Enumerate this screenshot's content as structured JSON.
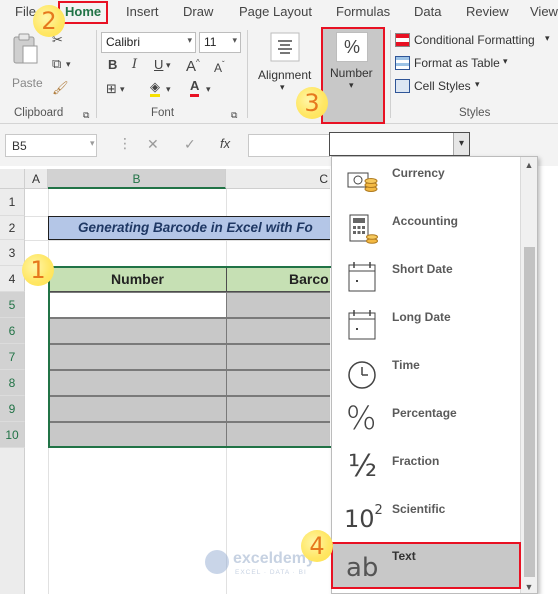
{
  "ribbon": {
    "tabs": [
      "File",
      "Home",
      "Insert",
      "Draw",
      "Page Layout",
      "Formulas",
      "Data",
      "Review",
      "View"
    ],
    "active_tab": "Home",
    "clipboard": {
      "paste_label": "Paste",
      "group_label": "Clipboard"
    },
    "font": {
      "family": "Calibri",
      "size": "11",
      "group_label": "Font",
      "bold": "B",
      "italic": "I",
      "underline": "U"
    },
    "alignment": {
      "label": "Alignment"
    },
    "number": {
      "label": "Number",
      "symbol": "%"
    },
    "styles": {
      "conditional_formatting": "Conditional Formatting",
      "format_as_table": "Format as Table",
      "cell_styles": "Cell Styles",
      "group_label": "Styles"
    }
  },
  "callouts": [
    "1",
    "2",
    "3",
    "4"
  ],
  "formula_bar": {
    "name_box": "B5",
    "cancel": "✕",
    "enter": "✓",
    "fx": "fx"
  },
  "sheet": {
    "columns": [
      "A",
      "B",
      "C"
    ],
    "rows": [
      "1",
      "2",
      "3",
      "4",
      "5",
      "6",
      "7",
      "8",
      "9",
      "10"
    ],
    "title": "Generating Barcode in Excel with Fo",
    "headers": {
      "number": "Number",
      "barcode": "Barco"
    }
  },
  "number_format_menu": {
    "items": [
      {
        "label": "Currency",
        "icon": "currency-icon"
      },
      {
        "label": "Accounting",
        "icon": "accounting-icon"
      },
      {
        "label": "Short Date",
        "icon": "short-date-icon"
      },
      {
        "label": "Long Date",
        "icon": "long-date-icon"
      },
      {
        "label": "Time",
        "icon": "clock-icon"
      },
      {
        "label": "Percentage",
        "icon": "percent-icon"
      },
      {
        "label": "Fraction",
        "icon": "fraction-icon"
      },
      {
        "label": "Scientific",
        "icon": "scientific-icon"
      },
      {
        "label": "Text",
        "icon": "text-ab-icon"
      }
    ],
    "selected": "Text",
    "icon_glyphs": {
      "fraction": "½",
      "scientific_base": "10",
      "scientific_exp": "2",
      "text": "ab",
      "percent": "%"
    }
  },
  "watermark": {
    "name": "exceldemy",
    "tagline": "EXCEL · DATA · BI"
  },
  "colors": {
    "excel_green": "#217346",
    "callout_red": "#e81123",
    "title_fill": "#b4c6e7",
    "header_fill": "#c6e0b4",
    "callout_fill": "#ffe766",
    "callout_text": "#e6781e"
  }
}
